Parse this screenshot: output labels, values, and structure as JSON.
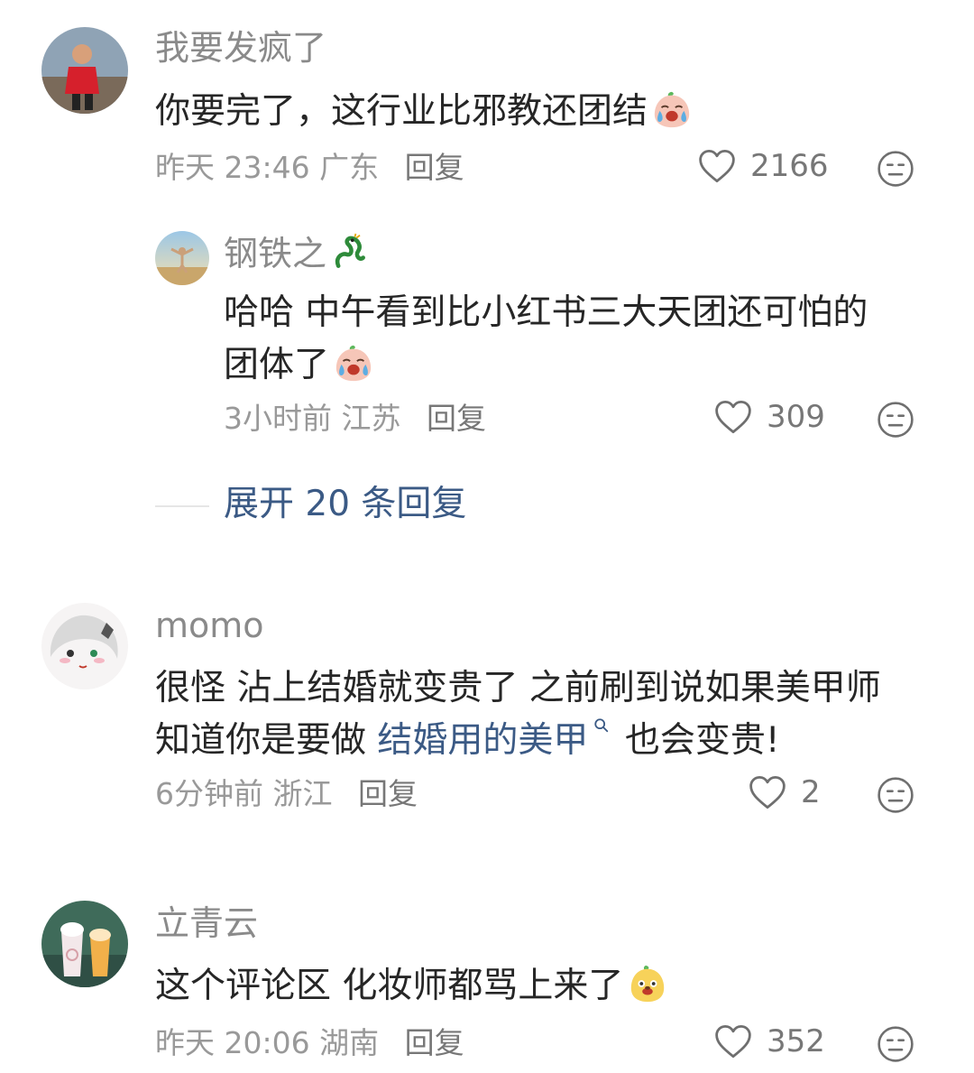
{
  "comments": [
    {
      "username": "我要发疯了",
      "text": "你要完了，这行业比邪教还团结",
      "emoji": "crying-laughing-peach-emoji",
      "time": "昨天 23:46",
      "location": "广东",
      "reply_label": "回复",
      "likes": "2166",
      "replies": [
        {
          "username": "钢铁之",
          "username_emoji": "dragon-emoji",
          "text_line1": "哈哈 中午看到比小红书三大天团还可怕的",
          "text_line2": "团体了",
          "emoji": "crying-laughing-peach-emoji",
          "time": "3小时前",
          "location": "江苏",
          "reply_label": "回复",
          "likes": "309"
        }
      ],
      "expand_label": "展开 20 条回复"
    },
    {
      "username": "momo",
      "text_line1": "很怪 沾上结婚就变贵了 之前刷到说如果美甲师",
      "text_line2_before": "知道你是要做 ",
      "link_text": "结婚用的美甲",
      "text_line2_after": " 也会变贵!",
      "time": "6分钟前",
      "location": "浙江",
      "reply_label": "回复",
      "likes": "2"
    },
    {
      "username": "立青云",
      "text": "这个评论区 化妆师都骂上来了",
      "emoji": "yellow-peach-dog-emoji",
      "time": "昨天 20:06",
      "location": "湖南",
      "reply_label": "回复",
      "likes": "352"
    }
  ],
  "colors": {
    "link": "#3b5a85",
    "username": "#8a8a8a",
    "meta": "#999999",
    "text": "#262626"
  }
}
